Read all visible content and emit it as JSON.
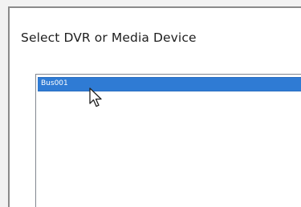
{
  "dialog": {
    "title": "Select DVR or Media Device"
  },
  "device_list": {
    "items": [
      {
        "label": "Bus001",
        "selected": true
      }
    ]
  },
  "colors": {
    "selection": "#2f7bd4",
    "window_border": "#8a8a8a",
    "background": "#ffffff"
  },
  "icons": {
    "cursor": "arrow-cursor-icon"
  }
}
